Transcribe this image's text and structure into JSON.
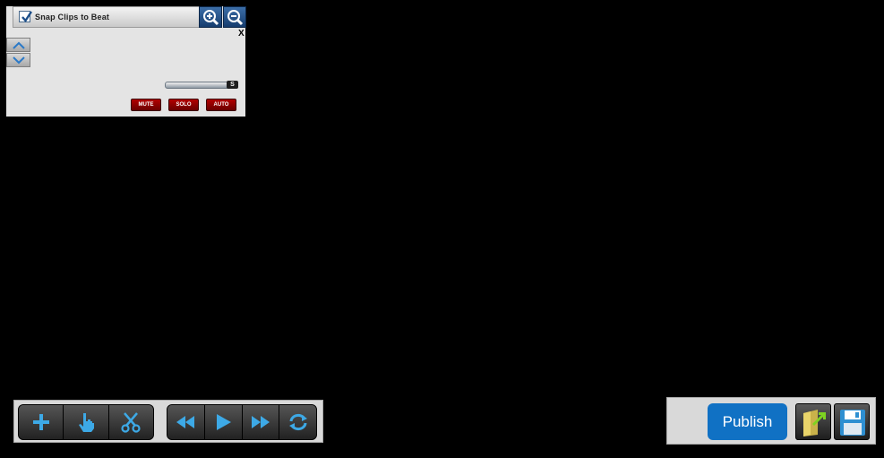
{
  "track_panel": {
    "snap_label": "Snap Clips to Beat",
    "snap_checked": true,
    "close_label": "X",
    "solo_knob_label": "S",
    "mute_label": "MUTE",
    "solo_label": "SOLO",
    "auto_label": "AUTO",
    "icons": [
      "zoom-in-icon",
      "zoom-out-icon",
      "scroll-up-icon",
      "scroll-down-icon"
    ]
  },
  "transport": {
    "edit_tools": [
      "add-icon",
      "hand-pointer-icon",
      "scissors-icon"
    ],
    "playback_tools": [
      "rewind-icon",
      "play-icon",
      "fast-forward-icon",
      "loop-icon"
    ],
    "accent_color": "#3da9e6"
  },
  "publish_panel": {
    "publish_label": "Publish",
    "publish_color": "#1071c4",
    "icons": [
      "export-icon",
      "save-icon"
    ]
  }
}
